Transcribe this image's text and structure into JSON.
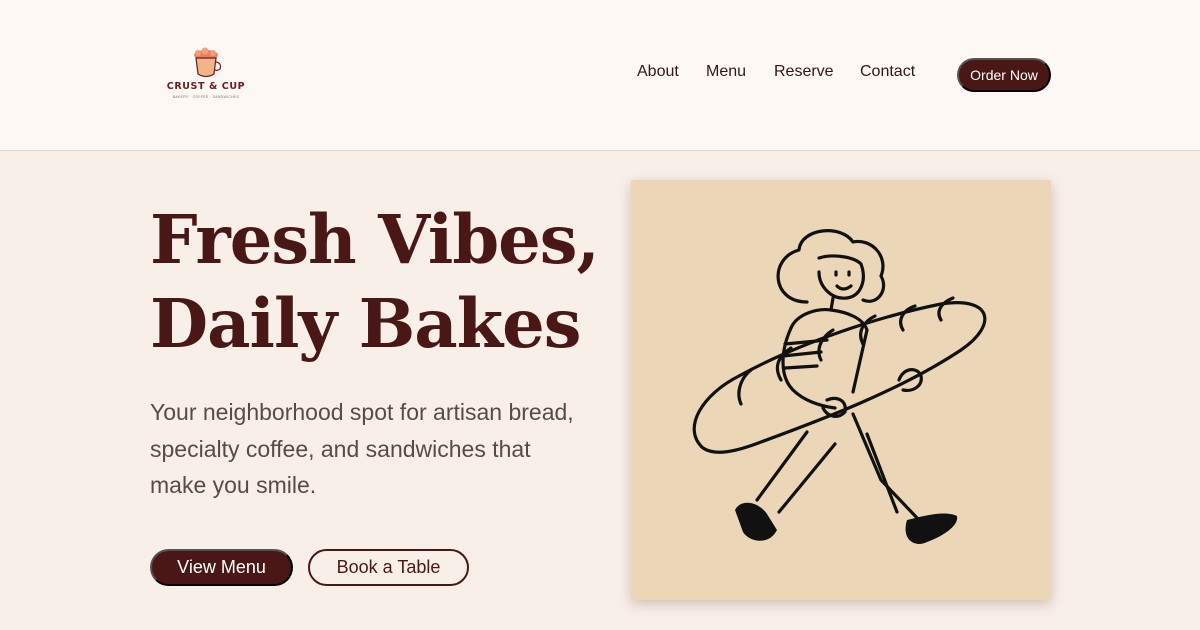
{
  "brand": {
    "name": "CRUST & CUP",
    "tagline": "BAKERY · COFFEE · SANDWICHES",
    "logo_icon": "coffee-cup-bread-icon"
  },
  "nav": {
    "items": [
      "About",
      "Menu",
      "Reserve",
      "Contact"
    ],
    "cta": "Order Now"
  },
  "hero": {
    "title_line1": "Fresh Vibes,",
    "title_line2": "Daily Bakes",
    "subtitle": "Your neighborhood spot for artisan bread, specialty coffee, and sandwiches that make you smile.",
    "primary_button": "View Menu",
    "secondary_button": "Book a Table",
    "illustration": "person-carrying-baguette-illustration"
  },
  "colors": {
    "brand_dark": "#4a1717",
    "header_bg": "#fdf8f4",
    "hero_bg": "#f9efe9",
    "illustration_bg": "#ecd6b8"
  }
}
